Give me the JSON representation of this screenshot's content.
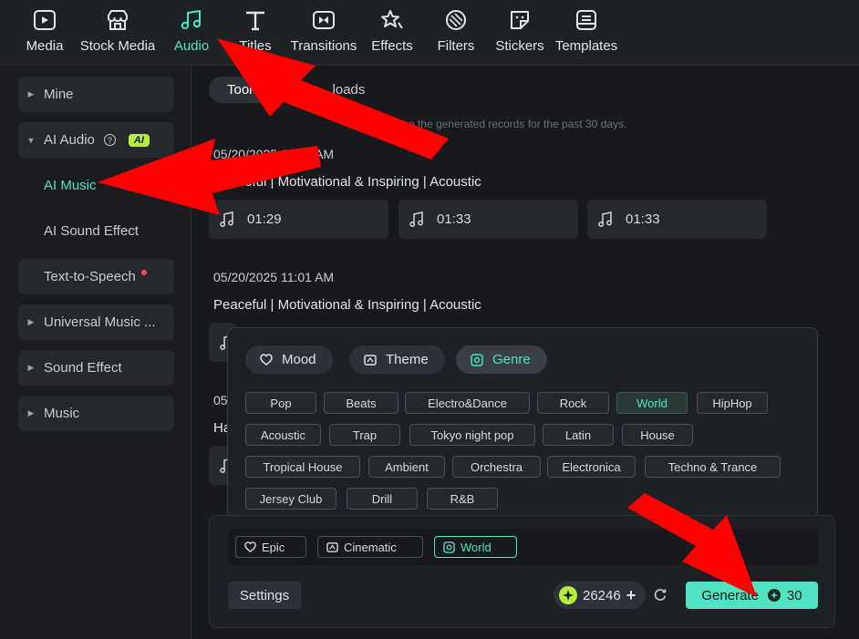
{
  "toolbar": {
    "items": [
      {
        "label": "Media",
        "icon": "media-icon"
      },
      {
        "label": "Stock Media",
        "icon": "stock-media-icon"
      },
      {
        "label": "Audio",
        "icon": "music-note-icon"
      },
      {
        "label": "Titles",
        "icon": "titles-icon"
      },
      {
        "label": "Transitions",
        "icon": "transitions-icon"
      },
      {
        "label": "Effects",
        "icon": "effects-icon"
      },
      {
        "label": "Filters",
        "icon": "filters-icon"
      },
      {
        "label": "Stickers",
        "icon": "stickers-icon"
      },
      {
        "label": "Templates",
        "icon": "templates-icon"
      }
    ],
    "active": "Audio"
  },
  "sidebar": {
    "items": [
      {
        "label": "Mine"
      },
      {
        "label": "AI Audio",
        "badge": "AI"
      },
      {
        "label": "AI Music"
      },
      {
        "label": "AI Sound Effect"
      },
      {
        "label": "Text-to-Speech"
      },
      {
        "label": "Universal Music ..."
      },
      {
        "label": "Sound Effect"
      },
      {
        "label": "Music"
      }
    ]
  },
  "main": {
    "tabs": [
      {
        "label": "Tool"
      },
      {
        "label": "loads"
      }
    ],
    "notice": "You can use the generated records for the past 30 days.",
    "records": [
      {
        "date": "05/20/2025 11:02 AM",
        "title": "Peaceful | Motivational & Inspiring | Acoustic",
        "tracks": [
          "01:29",
          "01:33",
          "01:33"
        ]
      },
      {
        "date": "05/20/2025 11:01 AM",
        "title": "Peaceful | Motivational & Inspiring | Acoustic"
      },
      {
        "date": "05",
        "title": "Ha"
      }
    ]
  },
  "genre_popup": {
    "categories": [
      {
        "label": "Mood",
        "icon": "mood-icon"
      },
      {
        "label": "Theme",
        "icon": "theme-icon"
      },
      {
        "label": "Genre",
        "icon": "genre-icon"
      }
    ],
    "active_category": "Genre",
    "genres": [
      "Pop",
      "Beats",
      "Electro&Dance",
      "Rock",
      "World",
      "HipHop",
      "Acoustic",
      "Trap",
      "Tokyo night pop",
      "Latin",
      "House",
      "Tropical House",
      "Ambient",
      "Orchestra",
      "Electronica",
      "Techno & Trance",
      "Jersey Club",
      "Drill",
      "R&B"
    ],
    "selected_genre": "World"
  },
  "prompt_panel": {
    "selected_tags": [
      {
        "label": "Epic",
        "icon": "mood-icon"
      },
      {
        "label": "Cinematic",
        "icon": "theme-icon"
      },
      {
        "label": "World",
        "icon": "genre-icon"
      }
    ],
    "settings_label": "Settings",
    "credits": "26246",
    "generate_label": "Generate",
    "generate_cost": "30"
  },
  "colors": {
    "accent": "#4fe3c1",
    "ai_badge": "#b6ef3a",
    "arrow": "#ff0000"
  }
}
